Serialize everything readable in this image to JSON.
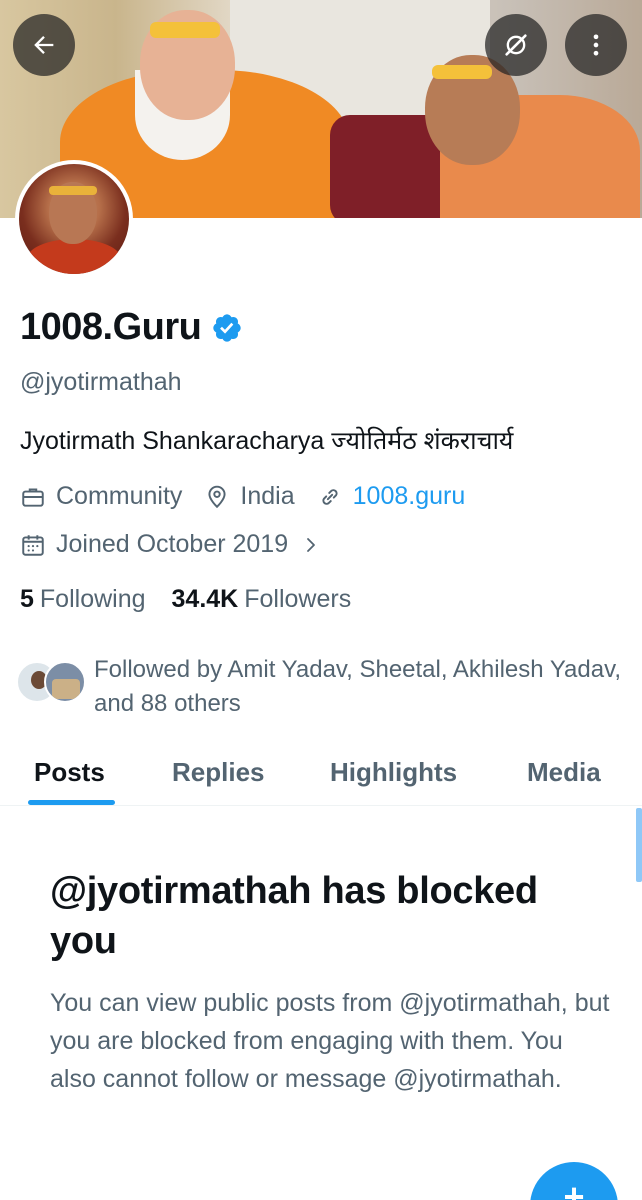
{
  "profile": {
    "display_name": "1008.Guru",
    "handle": "@jyotirmathah",
    "bio": "Jyotirmath Shankaracharya ज्योतिर्मठ शंकराचार्य",
    "category": "Community",
    "location": "India",
    "website": "1008.guru",
    "joined": "Joined October 2019"
  },
  "stats": {
    "following_count": "5",
    "following_label": "Following",
    "followers_count": "34.4K",
    "followers_label": "Followers"
  },
  "followed_by": "Followed by Amit Yadav, Sheetal, Akhilesh Yadav, and 88 others",
  "tabs": [
    {
      "label": "Posts",
      "active": true
    },
    {
      "label": "Replies",
      "active": false
    },
    {
      "label": "Highlights",
      "active": false
    },
    {
      "label": "Media",
      "active": false
    }
  ],
  "blocked": {
    "title": "@jyotirmathah has blocked you",
    "body": "You can view public posts from @jyotirmathah, but you are blocked from engaging with them. You also cannot follow or message @jyotirmathah."
  },
  "fab_label": "+",
  "colors": {
    "accent": "#1d9bf0",
    "text_primary": "#0f1419",
    "text_secondary": "#536471"
  },
  "icons": {
    "back": "back-arrow-icon",
    "grok": "grok-icon",
    "more": "more-vertical-icon",
    "verified": "verified-badge-icon",
    "category": "briefcase-icon",
    "location": "location-pin-icon",
    "website": "link-icon",
    "joined": "calendar-icon",
    "joined_more": "chevron-right-icon"
  }
}
